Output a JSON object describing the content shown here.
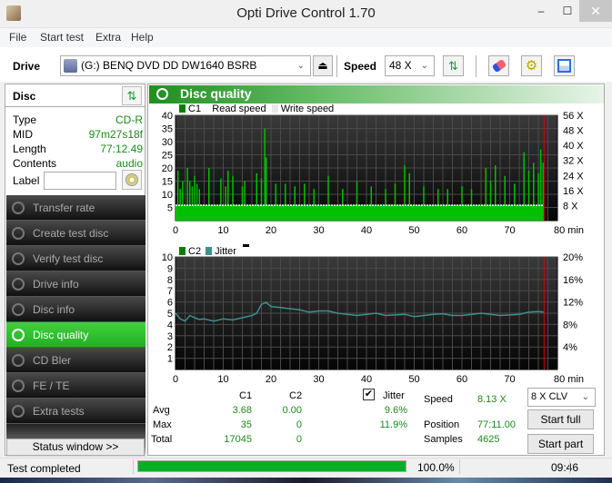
{
  "window": {
    "title": "Opti Drive Control 1.70",
    "minimize": "–",
    "maximize": "☐",
    "close": "✕"
  },
  "menu": [
    "File",
    "Start test",
    "Extra",
    "Help"
  ],
  "toolbar": {
    "drive_label": "Drive",
    "drive_value": "(G:)   BENQ DVD DD DW1640 BSRB",
    "eject_icon": "⏏",
    "speed_label": "Speed",
    "speed_value": "48 X",
    "refresh_icon": "⇅",
    "erase_icon": "eraser",
    "settings_icon": "gears",
    "save_icon": "floppy"
  },
  "disc": {
    "header": "Disc",
    "rows": [
      {
        "key": "Type",
        "value": "CD-R"
      },
      {
        "key": "MID",
        "value": "97m27s18f"
      },
      {
        "key": "Length",
        "value": "77:12.49"
      },
      {
        "key": "Contents",
        "value": "audio"
      }
    ],
    "label_key": "Label",
    "label_value": ""
  },
  "nav": [
    {
      "label": "Transfer rate",
      "active": false
    },
    {
      "label": "Create test disc",
      "active": false
    },
    {
      "label": "Verify test disc",
      "active": false
    },
    {
      "label": "Drive info",
      "active": false
    },
    {
      "label": "Disc info",
      "active": false
    },
    {
      "label": "Disc quality",
      "active": true
    },
    {
      "label": "CD Bler",
      "active": false
    },
    {
      "label": "FE / TE",
      "active": false
    },
    {
      "label": "Extra tests",
      "active": false
    }
  ],
  "status_window_button": "Status window >>",
  "panel_title": "Disc quality",
  "legend_top": {
    "c1": "C1",
    "read": "Read speed",
    "write": "Write speed"
  },
  "legend_bottom": {
    "c2": "C2",
    "jitter": "Jitter"
  },
  "colors": {
    "c1": "#00c000",
    "c2": "#008000",
    "jitter": "#3f8f8f",
    "marker": "#e00000",
    "speed_line": "#ffffff"
  },
  "chart_data": [
    {
      "type": "bar",
      "title": "C1 / Read speed",
      "xlabel": "min",
      "x_ticks": [
        0,
        10,
        20,
        30,
        40,
        50,
        60,
        70,
        80
      ],
      "x_tick_labels": [
        "0",
        "10",
        "20",
        "30",
        "40",
        "50",
        "60",
        "70",
        "80 min"
      ],
      "xlim": [
        0,
        80
      ],
      "ylim": [
        0,
        40
      ],
      "y_ticks": [
        5,
        10,
        15,
        20,
        25,
        30,
        35,
        40
      ],
      "y2_ticks": [
        "8 X",
        "16 X",
        "24 X",
        "32 X",
        "40 X",
        "48 X",
        "56 X"
      ],
      "y2lim": [
        0,
        56
      ],
      "end_marker_min": 77.2,
      "read_speed_x": 8.13,
      "c1_baseline": 5,
      "c1_peaks": [
        [
          0.5,
          19
        ],
        [
          1,
          12
        ],
        [
          1.5,
          15
        ],
        [
          2.5,
          20
        ],
        [
          3,
          15
        ],
        [
          3.5,
          13
        ],
        [
          4,
          17
        ],
        [
          4.5,
          14
        ],
        [
          5,
          12
        ],
        [
          7,
          20
        ],
        [
          9.5,
          16
        ],
        [
          10.5,
          13
        ],
        [
          11,
          19
        ],
        [
          12,
          17
        ],
        [
          14,
          13
        ],
        [
          14.5,
          15
        ],
        [
          17,
          18
        ],
        [
          18,
          16
        ],
        [
          18.7,
          35
        ],
        [
          19,
          24
        ],
        [
          21,
          14
        ],
        [
          23,
          14
        ],
        [
          25,
          13
        ],
        [
          27,
          14
        ],
        [
          29,
          12
        ],
        [
          32,
          17
        ],
        [
          35,
          12
        ],
        [
          38,
          15
        ],
        [
          41,
          13
        ],
        [
          44,
          12
        ],
        [
          46,
          14
        ],
        [
          48,
          21
        ],
        [
          49,
          18
        ],
        [
          52,
          13
        ],
        [
          55,
          12
        ],
        [
          57,
          12
        ],
        [
          60,
          13
        ],
        [
          62,
          12
        ],
        [
          65,
          20
        ],
        [
          66,
          15
        ],
        [
          67,
          21
        ],
        [
          69,
          17
        ],
        [
          71,
          14
        ],
        [
          73,
          26
        ],
        [
          74,
          19
        ],
        [
          75,
          22
        ],
        [
          76,
          18
        ],
        [
          76.5,
          27
        ],
        [
          77,
          22
        ]
      ]
    },
    {
      "type": "line",
      "title": "C2 / Jitter",
      "xlabel": "min",
      "x_ticks": [
        0,
        10,
        20,
        30,
        40,
        50,
        60,
        70,
        80
      ],
      "x_tick_labels": [
        "0",
        "10",
        "20",
        "30",
        "40",
        "50",
        "60",
        "70",
        "80 min"
      ],
      "xlim": [
        0,
        80
      ],
      "ylim": [
        0,
        10
      ],
      "y_ticks": [
        1,
        2,
        3,
        4,
        5,
        6,
        7,
        8,
        9,
        10
      ],
      "y2_ticks": [
        "4%",
        "8%",
        "12%",
        "16%",
        "20%"
      ],
      "y2lim": [
        0,
        20
      ],
      "end_marker_min": 77.2,
      "c2_values": "all 0",
      "jitter_percent": [
        [
          0,
          10.0
        ],
        [
          1,
          9.0
        ],
        [
          2,
          8.6
        ],
        [
          3,
          9.6
        ],
        [
          4,
          9.2
        ],
        [
          5,
          8.9
        ],
        [
          6,
          9.0
        ],
        [
          8,
          8.6
        ],
        [
          10,
          9.0
        ],
        [
          12,
          8.8
        ],
        [
          14,
          9.2
        ],
        [
          16,
          9.6
        ],
        [
          17,
          10.0
        ],
        [
          18,
          11.6
        ],
        [
          19,
          11.9
        ],
        [
          20,
          11.2
        ],
        [
          22,
          11.0
        ],
        [
          24,
          10.8
        ],
        [
          26,
          10.6
        ],
        [
          28,
          10.2
        ],
        [
          30,
          10.4
        ],
        [
          32,
          10.4
        ],
        [
          34,
          10.0
        ],
        [
          36,
          9.8
        ],
        [
          38,
          9.6
        ],
        [
          40,
          9.8
        ],
        [
          42,
          10.0
        ],
        [
          44,
          9.6
        ],
        [
          46,
          9.7
        ],
        [
          48,
          9.8
        ],
        [
          50,
          9.4
        ],
        [
          52,
          9.6
        ],
        [
          54,
          9.8
        ],
        [
          56,
          9.9
        ],
        [
          58,
          9.6
        ],
        [
          60,
          9.6
        ],
        [
          62,
          9.8
        ],
        [
          64,
          10.0
        ],
        [
          66,
          9.8
        ],
        [
          68,
          9.6
        ],
        [
          70,
          9.7
        ],
        [
          72,
          9.8
        ],
        [
          74,
          10.2
        ],
        [
          76,
          10.3
        ],
        [
          77.2,
          10.2
        ]
      ]
    }
  ],
  "stats": {
    "col_c1": "C1",
    "col_c2": "C2",
    "col_jitter": "Jitter",
    "jitter_checked": true,
    "rows": [
      {
        "label": "Avg",
        "c1": "3.68",
        "c2": "0.00",
        "jitter": "9.6%"
      },
      {
        "label": "Max",
        "c1": "35",
        "c2": "0",
        "jitter": "11.9%"
      },
      {
        "label": "Total",
        "c1": "17045",
        "c2": "0",
        "jitter": ""
      }
    ],
    "speed_label": "Speed",
    "speed_value": "8.13 X",
    "position_label": "Position",
    "position_value": "77:11.00",
    "samples_label": "Samples",
    "samples_value": "4625",
    "clv_value": "8 X CLV",
    "start_full": "Start full",
    "start_part": "Start part"
  },
  "statusbar": {
    "text": "Test completed",
    "progress": 100.0,
    "progress_text": "100.0%",
    "time": "09:46"
  }
}
